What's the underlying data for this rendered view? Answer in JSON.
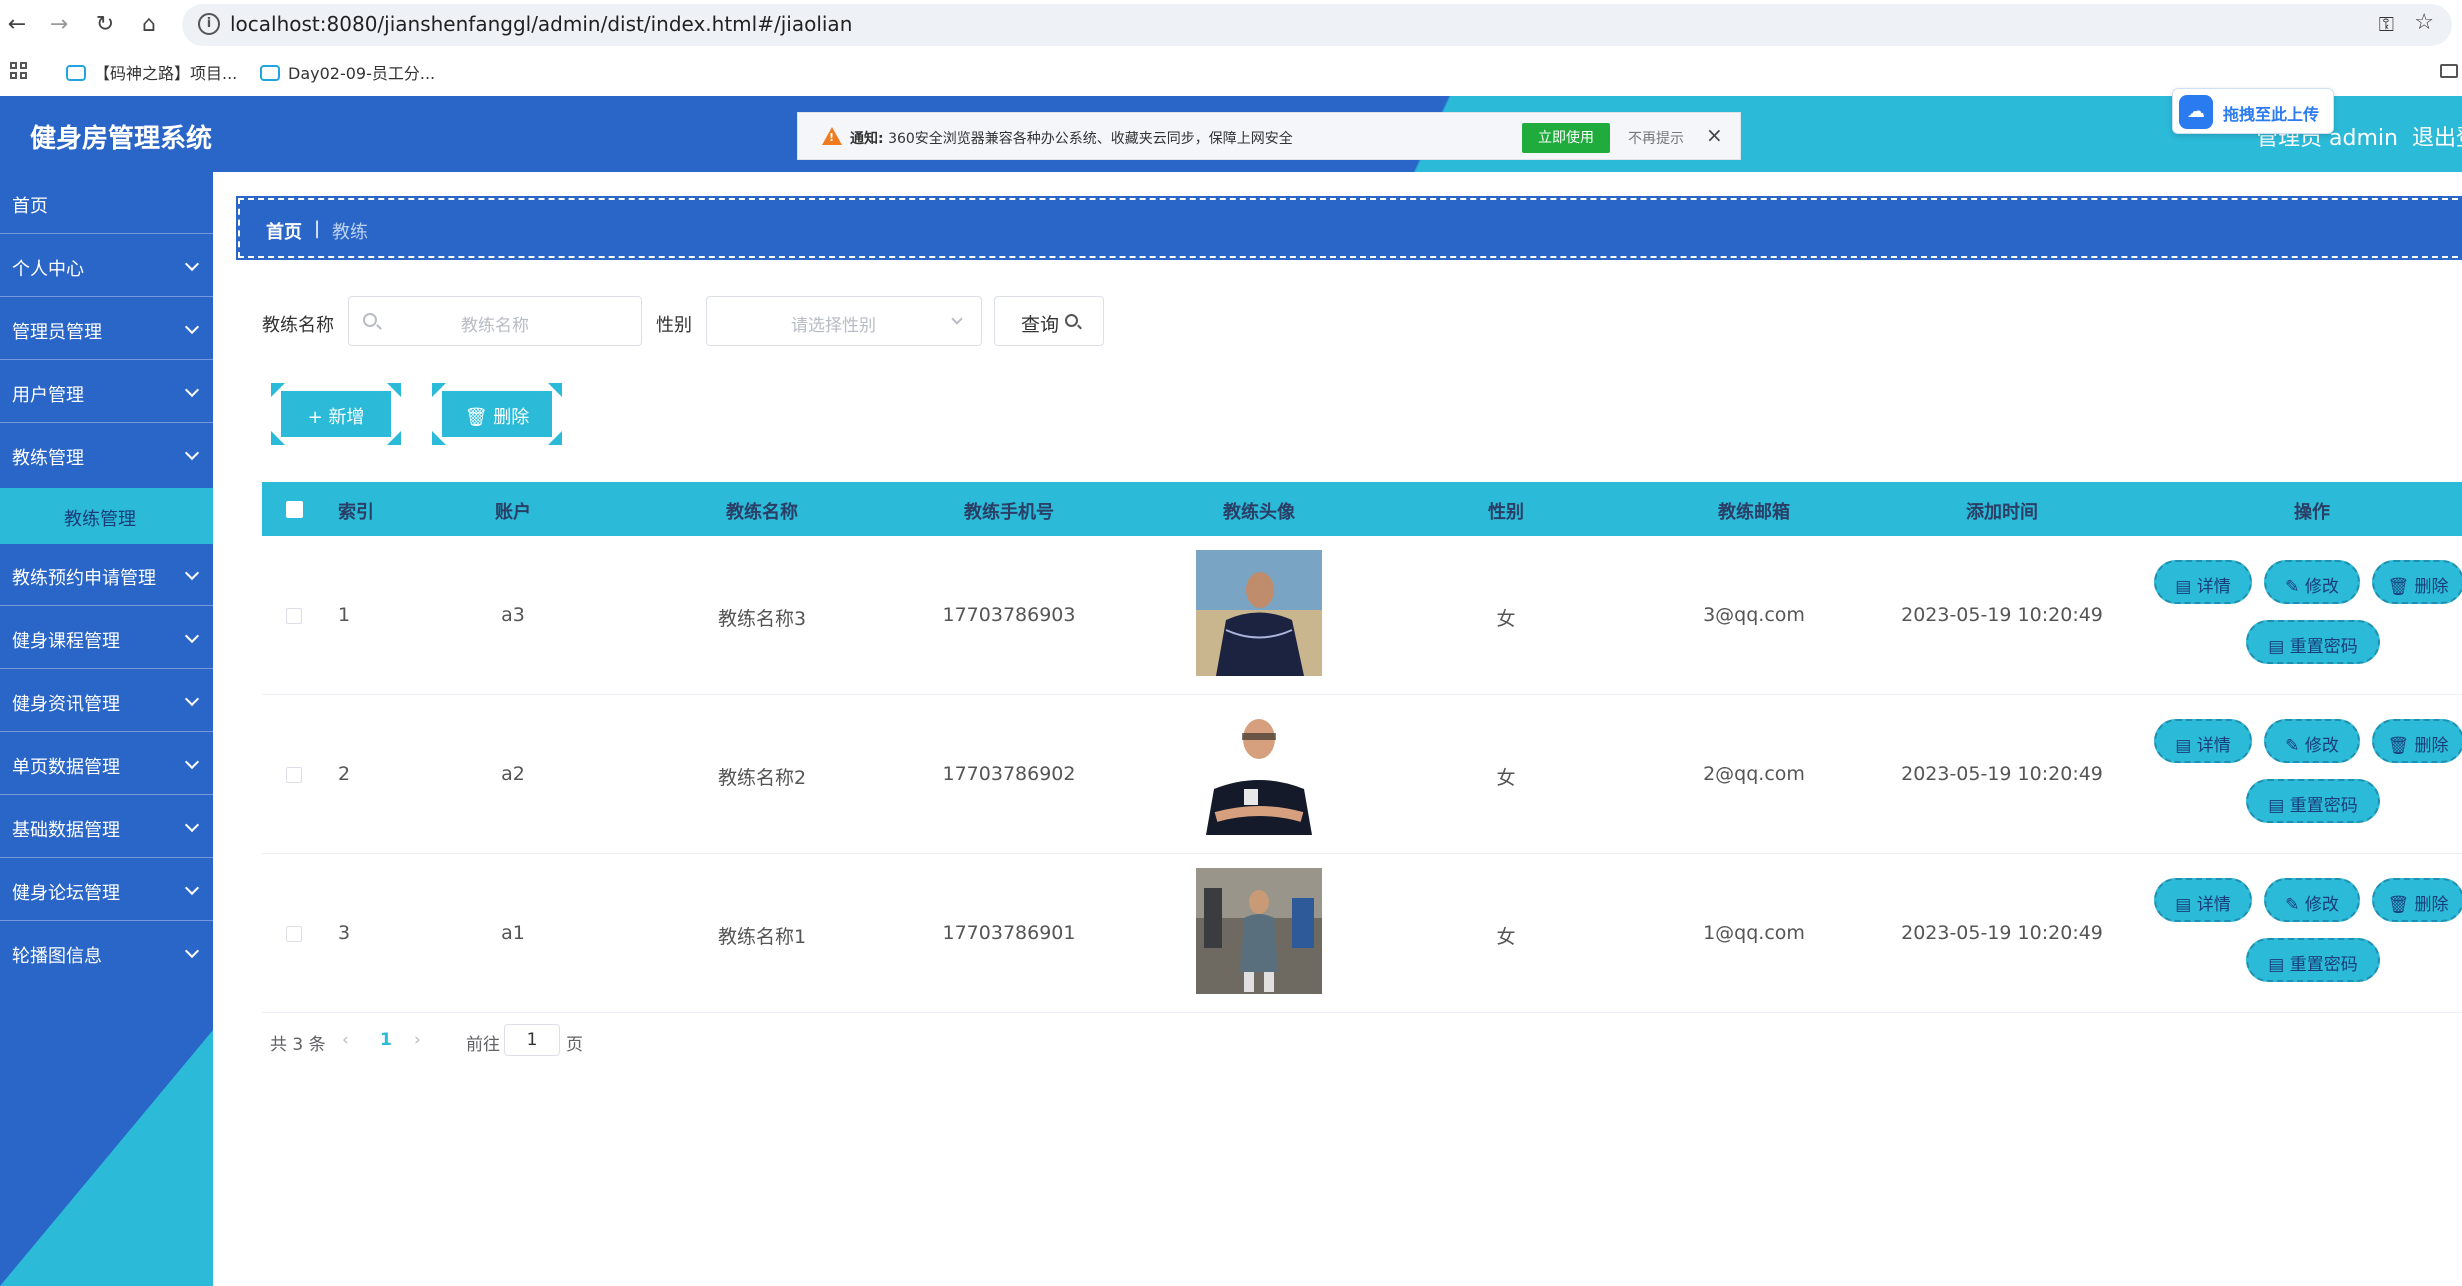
{
  "browser": {
    "url": "localhost:8080/jianshenfanggl/admin/dist/index.html#/jiaolian",
    "bookmarks": [
      "【码神之路】项目...",
      "Day02-09-员工分..."
    ]
  },
  "notice": {
    "prefix": "通知:",
    "message": "360安全浏览器兼容各种办公系统、收藏夹云同步，保障上网安全",
    "use_label": "立即使用",
    "dismiss_label": "不再提示",
    "close_glyph": "×"
  },
  "upload_pill": {
    "label": "拖拽至此上传"
  },
  "header": {
    "title": "健身房管理系统",
    "user": "管理员 admin",
    "logout": "退出登"
  },
  "sidebar": {
    "items": [
      {
        "label": "首页"
      },
      {
        "label": "个人中心"
      },
      {
        "label": "管理员管理"
      },
      {
        "label": "用户管理"
      },
      {
        "label": "教练管理"
      },
      {
        "label": "教练预约申请管理"
      },
      {
        "label": "健身课程管理"
      },
      {
        "label": "健身资讯管理"
      },
      {
        "label": "单页数据管理"
      },
      {
        "label": "基础数据管理"
      },
      {
        "label": "健身论坛管理"
      },
      {
        "label": "轮播图信息"
      }
    ],
    "sub_active": "教练管理"
  },
  "breadcrumb": {
    "home": "首页",
    "sep": "|",
    "current": "教练"
  },
  "filters": {
    "name_label": "教练名称",
    "name_placeholder": "教练名称",
    "gender_label": "性别",
    "gender_placeholder": "请选择性别",
    "query_label": "查询"
  },
  "toolbar": {
    "add_label": "+ 新增",
    "delete_label": "🗑 删除"
  },
  "table": {
    "headers": [
      "索引",
      "账户",
      "教练名称",
      "教练手机号",
      "教练头像",
      "性别",
      "教练邮箱",
      "添加时间",
      "操作"
    ],
    "rows": [
      {
        "index": "1",
        "account": "a3",
        "name": "教练名称3",
        "phone": "17703786903",
        "gender": "女",
        "email": "3@qq.com",
        "time": "2023-05-19 10:20:49"
      },
      {
        "index": "2",
        "account": "a2",
        "name": "教练名称2",
        "phone": "17703786902",
        "gender": "女",
        "email": "2@qq.com",
        "time": "2023-05-19 10:20:49"
      },
      {
        "index": "3",
        "account": "a1",
        "name": "教练名称1",
        "phone": "17703786901",
        "gender": "女",
        "email": "1@qq.com",
        "time": "2023-05-19 10:20:49"
      }
    ],
    "actions": {
      "detail": "详情",
      "edit": "修改",
      "delete": "删除",
      "reset": "重置密码"
    }
  },
  "pagination": {
    "total": "共 3 条",
    "prev": "‹",
    "current": "1",
    "next": "›",
    "goto": "前往",
    "page_value": "1",
    "page_suffix": "页"
  },
  "colors": {
    "primary_blue": "#2a65c8",
    "accent_cyan": "#2bbad8"
  }
}
